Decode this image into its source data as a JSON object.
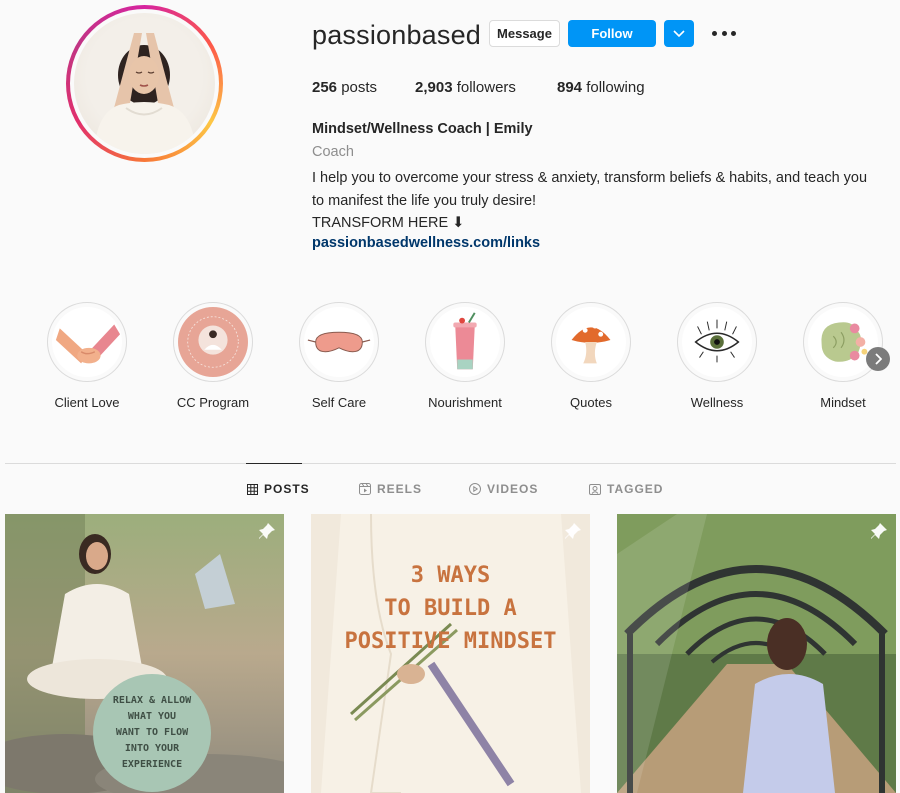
{
  "profile": {
    "username": "passionbased",
    "message_label": "Message",
    "follow_label": "Follow",
    "stats": {
      "posts_count": "256",
      "posts_label": "posts",
      "followers_count": "2,903",
      "followers_label": "followers",
      "following_count": "894",
      "following_label": "following"
    },
    "bio": {
      "name": "Mindset/Wellness Coach | Emily",
      "category": "Coach",
      "text": "I help you to overcome your stress & anxiety, transform beliefs & habits, and teach you to manifest the life you truly desire!",
      "cta": "TRANSFORM HERE ⬇",
      "link": "passionbasedwellness.com/links"
    }
  },
  "highlights": [
    {
      "label": "Client Love",
      "icon": "holding-hands-icon"
    },
    {
      "label": "CC Program",
      "icon": "connected-collective-badge"
    },
    {
      "label": "Self Care",
      "icon": "sleep-mask-icon"
    },
    {
      "label": "Nourishment",
      "icon": "smoothie-icon"
    },
    {
      "label": "Quotes",
      "icon": "mushroom-icon"
    },
    {
      "label": "Wellness",
      "icon": "eye-icon"
    },
    {
      "label": "Mindset",
      "icon": "brain-flowers-icon"
    }
  ],
  "tabs": [
    {
      "label": "POSTS",
      "icon": "grid-icon",
      "active": true
    },
    {
      "label": "REELS",
      "icon": "reels-icon",
      "active": false
    },
    {
      "label": "VIDEOS",
      "icon": "play-icon",
      "active": false
    },
    {
      "label": "TAGGED",
      "icon": "tag-icon",
      "active": false
    }
  ],
  "posts": [
    {
      "overlay_text": [
        "RELAX & ALLOW",
        "WHAT YOU",
        "WANT TO FLOW",
        "INTO YOUR",
        "EXPERIENCE"
      ],
      "pinned": true
    },
    {
      "overlay_text": [
        "3 WAYS",
        "TO BUILD A",
        "POSITIVE MINDSET"
      ],
      "pinned": true
    },
    {
      "overlay_text": [],
      "pinned": true
    }
  ],
  "colors": {
    "accent": "#0095f6",
    "link": "#00376b",
    "muted": "#8e8e8e",
    "post_text_orange": "#c8733f"
  }
}
